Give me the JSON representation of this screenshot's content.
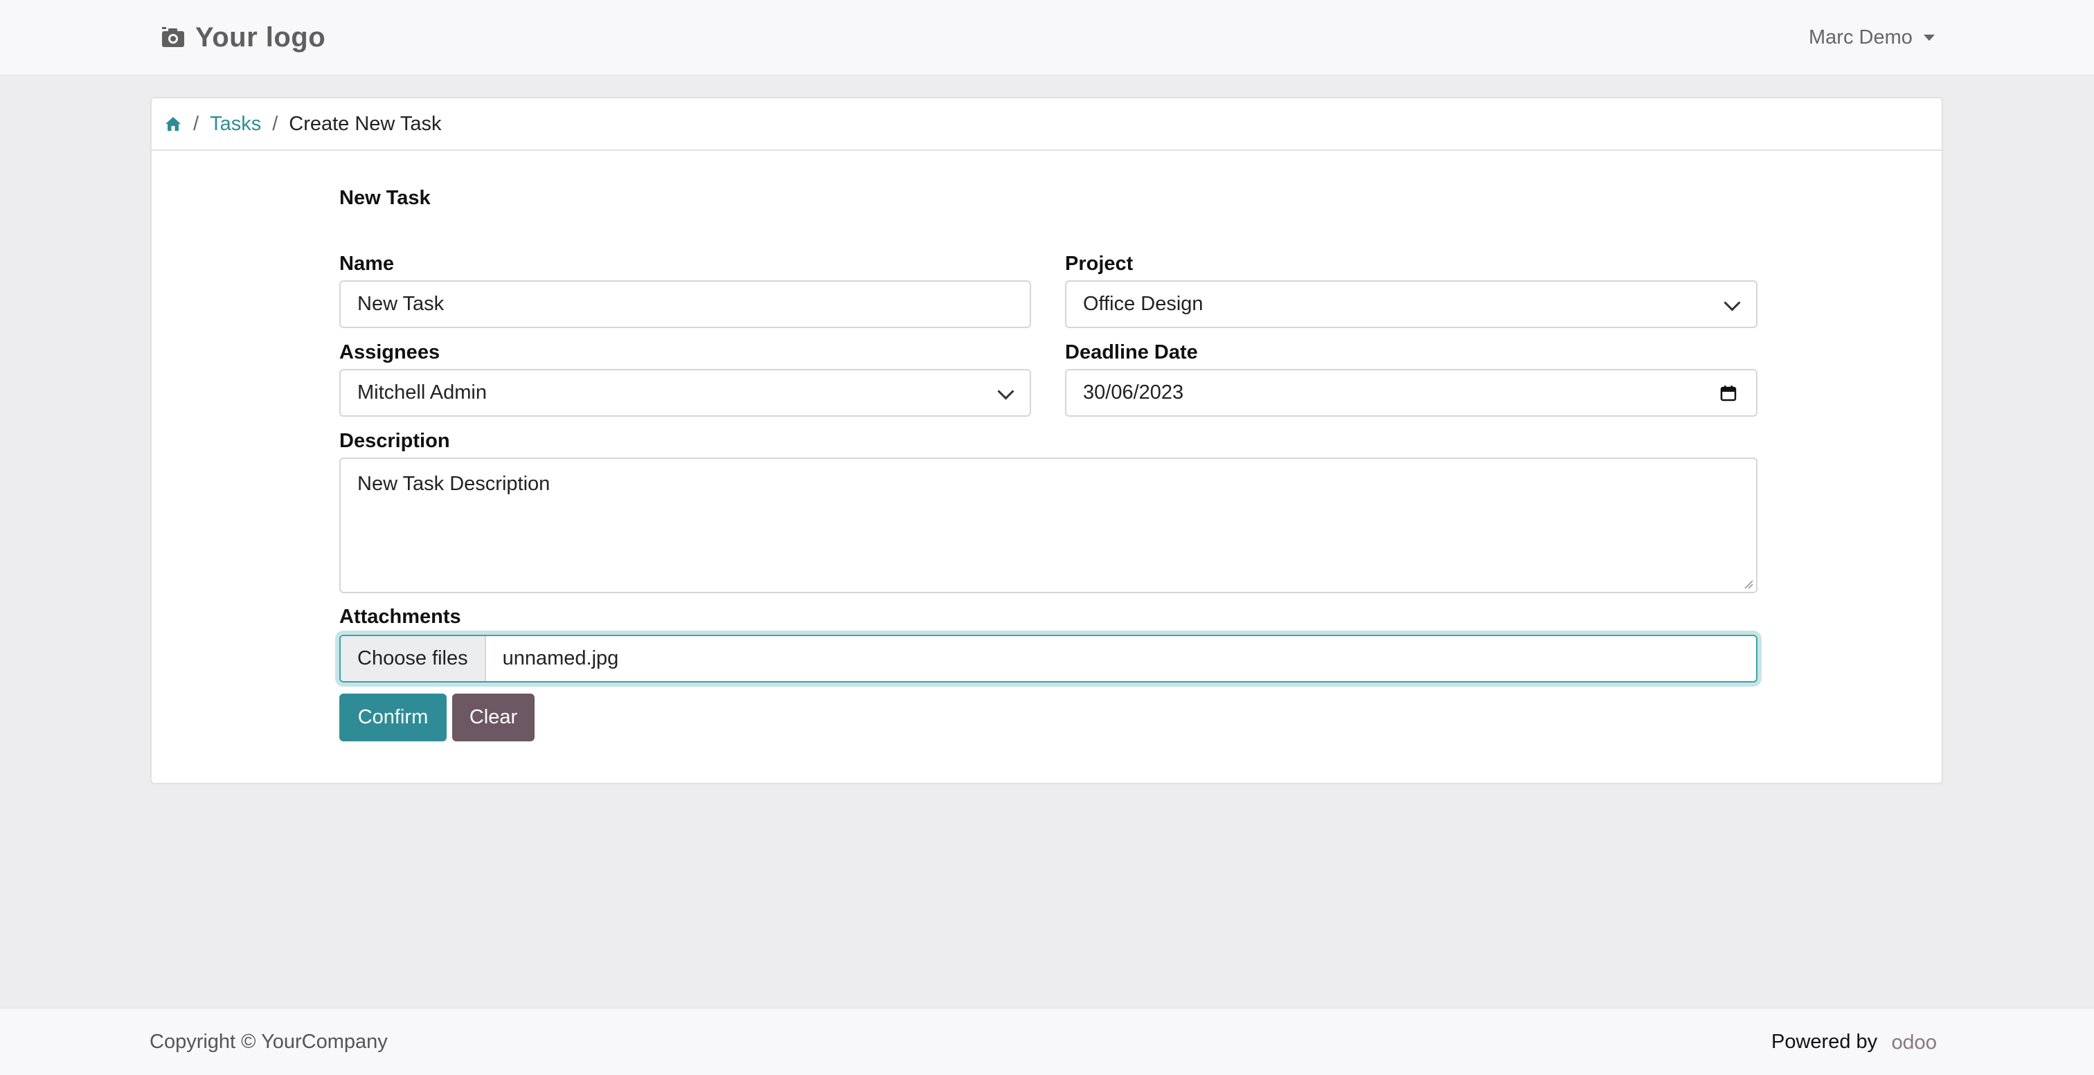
{
  "header": {
    "logo_text": "Your logo",
    "user_name": "Marc Demo"
  },
  "breadcrumb": {
    "home_icon": "home-icon",
    "tasks": "Tasks",
    "current": "Create New Task"
  },
  "form": {
    "title": "New Task",
    "name_label": "Name",
    "name_value": "New Task",
    "project_label": "Project",
    "project_value": "Office Design",
    "assignees_label": "Assignees",
    "assignees_value": "Mitchell Admin",
    "deadline_label": "Deadline Date",
    "deadline_value": "30/06/2023",
    "description_label": "Description",
    "description_value": "New Task Description",
    "attachments_label": "Attachments",
    "choose_files": "Choose files",
    "file_name": "unnamed.jpg",
    "confirm": "Confirm",
    "clear": "Clear"
  },
  "footer": {
    "copyright": "Copyright © YourCompany",
    "powered_by": "Powered by",
    "odoo": "odoo"
  },
  "colors": {
    "primary": "#2f8c96",
    "secondary": "#6b5862",
    "background": "#edecee"
  }
}
